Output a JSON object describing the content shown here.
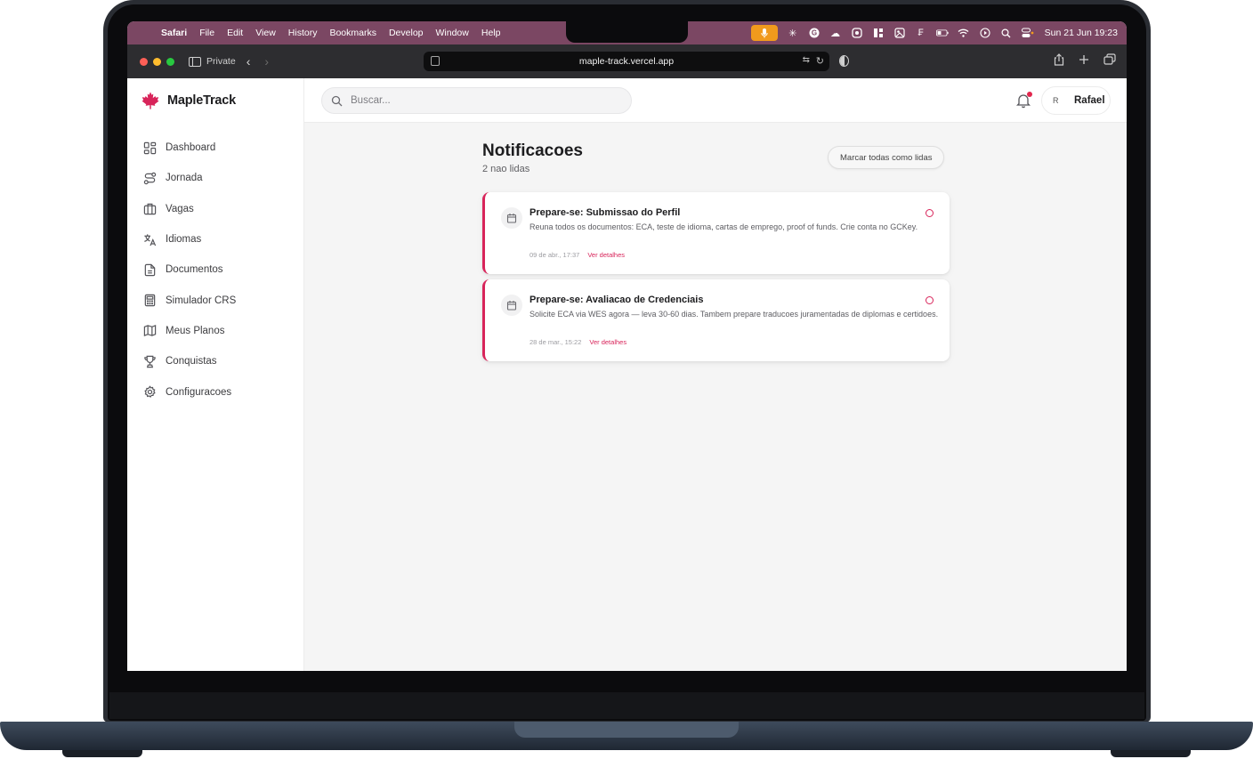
{
  "menubar": {
    "app_name": "Safari",
    "items": [
      "File",
      "Edit",
      "View",
      "History",
      "Bookmarks",
      "Develop",
      "Window",
      "Help"
    ],
    "clock": "Sun 21 Jun  19:23"
  },
  "browser": {
    "private_label": "Private",
    "url": "maple-track.vercel.app"
  },
  "brand": {
    "name": "MapleTrack",
    "color": "#d8245a"
  },
  "sidebar": {
    "items": [
      {
        "label": "Dashboard",
        "icon": "dashboard-icon"
      },
      {
        "label": "Jornada",
        "icon": "route-icon"
      },
      {
        "label": "Vagas",
        "icon": "briefcase-icon"
      },
      {
        "label": "Idiomas",
        "icon": "languages-icon"
      },
      {
        "label": "Documentos",
        "icon": "document-icon"
      },
      {
        "label": "Simulador CRS",
        "icon": "calculator-icon"
      },
      {
        "label": "Meus Planos",
        "icon": "map-icon"
      },
      {
        "label": "Conquistas",
        "icon": "trophy-icon"
      },
      {
        "label": "Configuracoes",
        "icon": "gear-icon"
      }
    ]
  },
  "topbar": {
    "search_placeholder": "Buscar...",
    "user_initial": "R",
    "user_name": "Rafael"
  },
  "page": {
    "title": "Notificacoes",
    "subtitle": "2 nao lidas",
    "mark_all_label": "Marcar todas como lidas"
  },
  "notifications": [
    {
      "title": "Prepare-se: Submissao do Perfil",
      "description": "Reuna todos os documentos: ECA, teste de idioma, cartas de emprego, proof of funds. Crie conta no GCKey.",
      "timestamp": "09 de abr., 17:37",
      "link_label": "Ver detalhes"
    },
    {
      "title": "Prepare-se: Avaliacao de Credenciais",
      "description": "Solicite ECA via WES agora — leva 30-60 dias. Tambem prepare traducoes juramentadas de diplomas e certidoes.",
      "timestamp": "28 de mar., 15:22",
      "link_label": "Ver detalhes"
    }
  ]
}
